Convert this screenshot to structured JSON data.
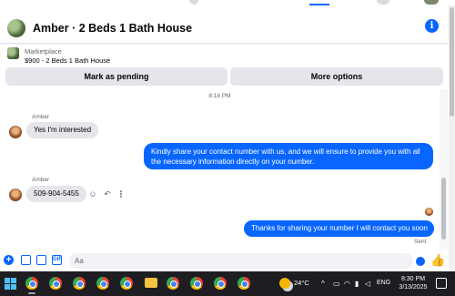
{
  "header": {
    "title": "Amber · 2 Beds 1 Bath House",
    "info_icon": "i"
  },
  "marketplace": {
    "label": "Marketplace",
    "item": "$900 - 2 Beds 1 Bath House",
    "buttons": {
      "pending": "Mark as pending",
      "more": "More options"
    }
  },
  "messages": {
    "timestamp": "8:18 PM",
    "sender_name": "Amber",
    "in_1": "Yes I'm interested",
    "out_1_line1": "Kindly share your contact number with us, and we will ensure to provide you with all",
    "out_1_line2": "the necessary information directly on your number.",
    "sender_name_2": "Amber",
    "in_2": "509-904-5455",
    "out_2": "Thanks for sharing your number I will contact you soon",
    "sent_status": "Sent"
  },
  "composer": {
    "placeholder": "Aa"
  },
  "taskbar": {
    "temperature": "24°C",
    "language": "ENG",
    "time": "8:30 PM",
    "date": "3/13/2025"
  },
  "colors": {
    "accent": "#0866ff",
    "bubble_in": "#e4e6eb",
    "taskbar": "#1d1d22"
  }
}
